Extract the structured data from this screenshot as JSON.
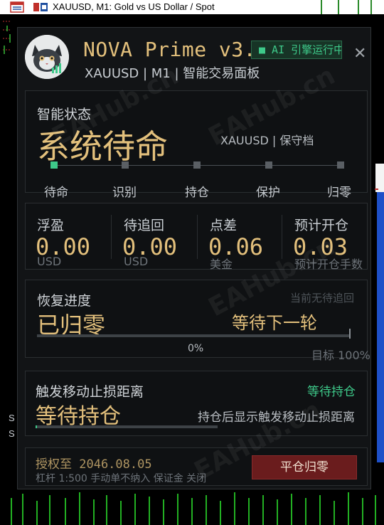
{
  "terminal": {
    "chart_title": "XAUUSD, M1:  Gold vs US Dollar / Spot",
    "side_labels": [
      "S",
      "S"
    ]
  },
  "panel": {
    "title": "NOVA Prime v3.",
    "subtitle": "XAUUSD | M1 | 智能交易面板",
    "ai_badge": "■ AI 引擎运行中",
    "close": "✕",
    "watermark": "EAHub.cn"
  },
  "status": {
    "label": "智能状态",
    "state": "系统待命",
    "info": "XAUUSD | 保守档",
    "steps": [
      "待命",
      "识别",
      "持仓",
      "保护",
      "归零"
    ],
    "active_step": 0
  },
  "stats": [
    {
      "label": "浮盈",
      "value": "0.00",
      "unit": "USD"
    },
    {
      "label": "待追回",
      "value": "0.00",
      "unit": "USD"
    },
    {
      "label": "点差",
      "value": "0.06",
      "unit": "美金"
    },
    {
      "label": "预计开仓",
      "value": "0.03",
      "unit": "预计开仓手数"
    }
  ],
  "recovery": {
    "label": "恢复进度",
    "note": "当前无待追回",
    "state": "已归零",
    "next": "等待下一轮",
    "progress": 0,
    "progress_text": "0%",
    "target": "目标 100%"
  },
  "trailing": {
    "label": "触发移动止损距离",
    "status": "等待持仓",
    "state": "等待持仓",
    "hint": "持仓后显示触发移动止损距离"
  },
  "license": {
    "label": "授权至 2046.08.05",
    "detail": "杠杆 1:500 手动单不纳入  保证金 关闭",
    "close_button": "平仓归零"
  },
  "colors": {
    "gold": "#e3c07c",
    "green": "#3ec98a",
    "danger": "#6a1c1d"
  }
}
